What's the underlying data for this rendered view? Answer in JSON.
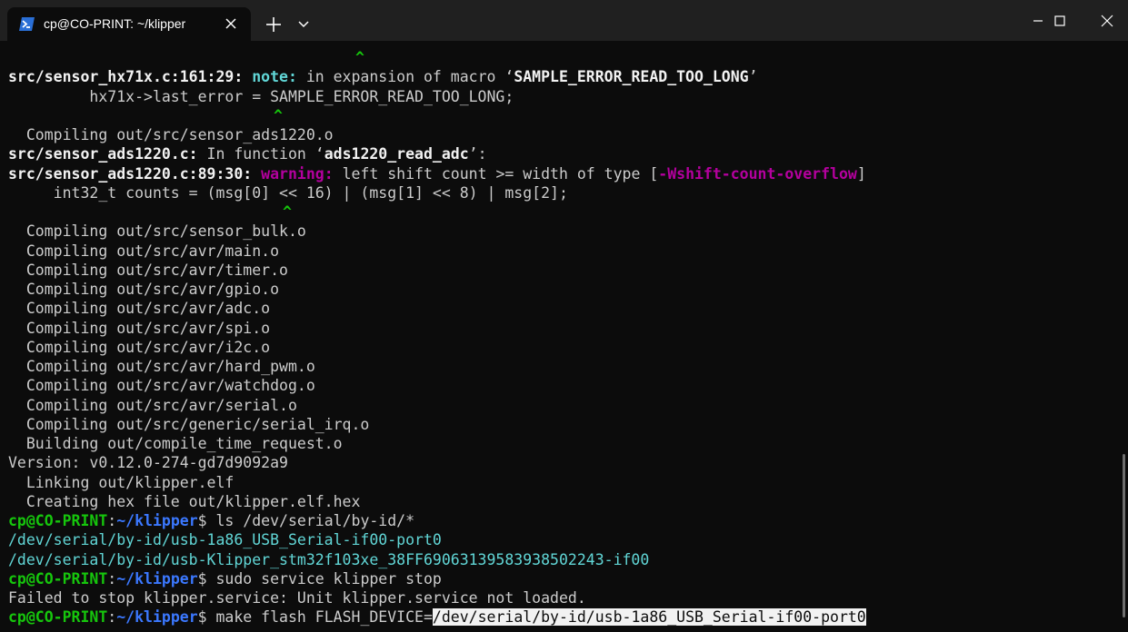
{
  "window": {
    "tab_title": "cp@CO-PRINT: ~/klipper"
  },
  "icons": {
    "tab": "powershell-terminal-icon",
    "close_tab": "close-icon",
    "new_tab": "plus-icon",
    "tab_menu": "chevron-down-icon",
    "minimize": "minimize-icon",
    "maximize": "maximize-icon",
    "close_window": "close-icon"
  },
  "colors": {
    "background": "#0c0c0c",
    "titlebar": "#202020",
    "prompt_green": "#16c60c",
    "path_blue": "#3b78ff",
    "note_cyan": "#61d6d6",
    "warning_magenta": "#b4009e"
  },
  "terminal": {
    "l0": "^",
    "l1a": "src/sensor_hx71x.c:161:29: ",
    "l1b": "note:",
    "l1c": " in expansion of macro ‘",
    "l1d": "SAMPLE_ERROR_READ_TOO_LONG",
    "l1e": "’",
    "l2": "         hx71x->last_error = SAMPLE_ERROR_READ_TOO_LONG;",
    "l3": "^",
    "l4": "  Compiling out/src/sensor_ads1220.o",
    "l5a": "src/sensor_ads1220.c:",
    "l5b": " In function ‘",
    "l5c": "ads1220_read_adc",
    "l5d": "’:",
    "l6a": "src/sensor_ads1220.c:89:30: ",
    "l6b": "warning:",
    "l6c": " left shift count >= width of type [",
    "l6d": "-Wshift-count-overflow",
    "l6e": "]",
    "l7": "     int32_t counts = (msg[0] << 16) | (msg[1] << 8) | msg[2];",
    "l8": "^",
    "l9": "  Compiling out/src/sensor_bulk.o",
    "l10": "  Compiling out/src/avr/main.o",
    "l11": "  Compiling out/src/avr/timer.o",
    "l12": "  Compiling out/src/avr/gpio.o",
    "l13": "  Compiling out/src/avr/adc.o",
    "l14": "  Compiling out/src/avr/spi.o",
    "l15": "  Compiling out/src/avr/i2c.o",
    "l16": "  Compiling out/src/avr/hard_pwm.o",
    "l17": "  Compiling out/src/avr/watchdog.o",
    "l18": "  Compiling out/src/avr/serial.o",
    "l19": "  Compiling out/src/generic/serial_irq.o",
    "l20": "  Building out/compile_time_request.o",
    "l21": "Version: v0.12.0-274-gd7d9092a9",
    "l22": "  Linking out/klipper.elf",
    "l23": "  Creating hex file out/klipper.elf.hex",
    "prompt_user": "cp@CO-PRINT",
    "prompt_colon": ":",
    "prompt_path": "~/klipper",
    "prompt_dollar": "$",
    "cmd1": " ls /dev/serial/by-id/*",
    "out1": "/dev/serial/by-id/usb-1a86_USB_Serial-if00-port0",
    "out2": "/dev/serial/by-id/usb-Klipper_stm32f103xe_38FF6906313958393850224З-if00",
    "cmd2": " sudo service klipper stop",
    "out3": "Failed to stop klipper.service: Unit klipper.service not loaded.",
    "cmd3": " make flash FLASH_DEVICE=",
    "cmd3_selected": "/dev/serial/by-id/usb-1a86_USB_Serial-if00-port0"
  }
}
